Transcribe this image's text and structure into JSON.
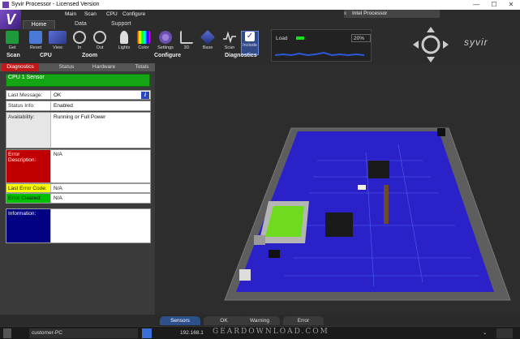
{
  "window": {
    "title": "Syvir Processor - Licensed Version"
  },
  "menu": {
    "items": [
      "Main",
      "Scan",
      "CPU",
      "Configure"
    ]
  },
  "tabs": {
    "home": "Home",
    "data": "Data",
    "support": "Support"
  },
  "doc_tab": {
    "label": "Intel Processor",
    "close": "x"
  },
  "ribbon": {
    "buttons": {
      "get": "Get",
      "reset": "Reset",
      "view": "View",
      "in": "In",
      "out": "Out",
      "lights": "Lights",
      "color": "Color",
      "settings": "Settings",
      "three_d": "3D",
      "base": "Base",
      "scan": "Scan",
      "include": "Include"
    },
    "groups": {
      "scan": "Scan",
      "cpu": "CPU",
      "zoom": "Zoom",
      "configure": "Configure",
      "diagnostics": "Diagnostics"
    }
  },
  "load": {
    "label": "Load",
    "percent": "20%",
    "level": 0.2
  },
  "brand": "Syvir",
  "subtabs": [
    "Diagnostics",
    "Status",
    "Hardware",
    "Totals"
  ],
  "sensor": {
    "name": "CPU 1 Sensor",
    "fields": [
      {
        "label": "Last Message:",
        "value": "OK"
      },
      {
        "label": "Status Info:",
        "value": "Enabled"
      },
      {
        "label": "Availability:",
        "value": "Running or Full Power"
      },
      {
        "label": "Error Description:",
        "value": "N/A"
      },
      {
        "label": "Last Error Code:",
        "value": "N/A"
      },
      {
        "label": "Error Cleared:",
        "value": "N/A"
      },
      {
        "label": "Information:",
        "value": ""
      }
    ],
    "info_icon": "i"
  },
  "status_tabs": [
    "Sensors",
    "OK",
    "Warning",
    "Error"
  ],
  "taskbar": {
    "item1": "customer-PC",
    "item2": "192.168.1",
    "watermark": "GEARDOWNLOAD.COM"
  },
  "colors": {
    "accent_purple": "#6a3fb0",
    "sensor_green": "#14a514",
    "error_red": "#c00000",
    "warn_yellow": "#ffff00",
    "ok_green": "#00c000",
    "info_navy": "#000080",
    "board_blue": "#2a22c8"
  }
}
